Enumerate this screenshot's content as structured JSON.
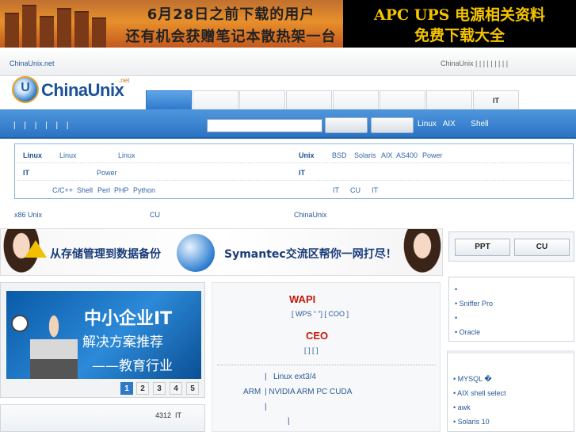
{
  "banners": {
    "left_line1": "6月28日之前下载的用户",
    "left_line2": "还有机会获赠笔记本散热架一台",
    "right_line1": "APC UPS 电源相关资料",
    "right_line2": "免费下载大全"
  },
  "topbar": {
    "site_link": "ChinaUnix.net",
    "right_text": "ChinaUnix | | | | | | | | |"
  },
  "logo": {
    "letter": "U",
    "name": "ChinaUnix",
    "suffix": ".net"
  },
  "nav": {
    "tabs": [
      "",
      "",
      "",
      "",
      "",
      "",
      "",
      "IT"
    ],
    "active_index": 0
  },
  "searchbar": {
    "pipes": "| | | | | |",
    "input_value": "",
    "links": [
      "Linux",
      "AIX",
      "Shell"
    ]
  },
  "categories": {
    "row1": [
      "Linux",
      "Linux",
      "Linux",
      "Unix",
      "BSD",
      "Solaris",
      "AIX",
      "AS400",
      "Power"
    ],
    "row2": [
      "IT",
      "Power",
      "IT"
    ],
    "row3": [
      "C/C++",
      "Shell",
      "Perl",
      "PHP",
      "Python",
      "IT",
      "CU",
      "IT"
    ]
  },
  "linkline": [
    "x86 Unix",
    "CU",
    "ChinaUnix"
  ],
  "symantec_banner": {
    "left_text": "从存储管理到数据备份",
    "right_text": "Symantec交流区帮你一网打尽！"
  },
  "right_buttons": [
    "PPT",
    "CU"
  ],
  "right_list1": [
    "•",
    "• Sniffer Pro",
    "•",
    "• Oracle"
  ],
  "right_list2": [
    "• MYSQL �",
    "• AIX shell select",
    "•    awk",
    "• Solaris 10"
  ],
  "slideshow": {
    "title": "中小企业IT",
    "line2": "解决方案推荐",
    "line3": "——教育行业",
    "pages": [
      "1",
      "2",
      "3",
      "4",
      "5"
    ],
    "current_page": 1
  },
  "leftbox2": {
    "count": "4312",
    "label": "IT"
  },
  "news": {
    "headline1": "WAPI",
    "sub1": "[ WPS “  ”] [ COO    ]",
    "headline2": "CEO",
    "sub2": "[      ] [      ]",
    "rows": [
      {
        "col1": "|",
        "col2": "Linux ext3/4"
      },
      {
        "col1": "ARM",
        "col2": "| NVIDIA ARM   PC CUDA"
      },
      {
        "col1": "|",
        "col2": ""
      },
      {
        "col1": "",
        "col2": "|"
      }
    ]
  },
  "colors": {
    "accent_blue": "#2f7acc",
    "headline_red": "#c5170e",
    "link_blue": "#2a5a98"
  }
}
